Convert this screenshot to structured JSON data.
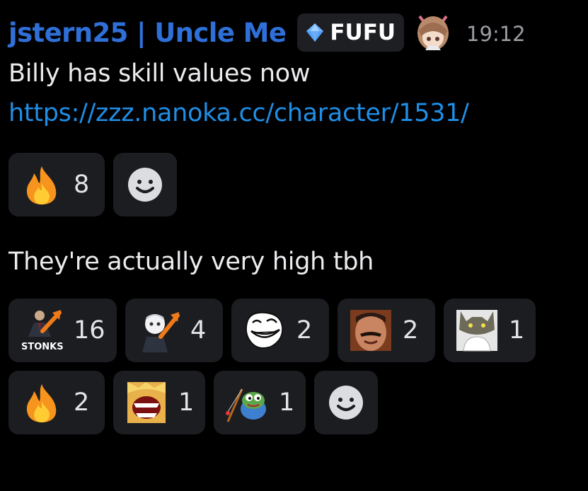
{
  "message_header": {
    "username": "jstern25 | Uncle Me",
    "username_color": "#2f6fd8",
    "tag_icon": "gem-icon",
    "tag_label": "FUFU",
    "timestamp": "19:12"
  },
  "messages": [
    {
      "text": "Billy has skill values now",
      "link": "https://zzz.nanoka.cc/character/1531/",
      "link_color": "#1f8ee6",
      "reactions": [
        {
          "emoji": "fire-emoji",
          "count": "8"
        }
      ]
    },
    {
      "text": "They're actually very high tbh",
      "reactions": [
        {
          "emoji": "stonks-emoji",
          "count": "16",
          "caption": "STONKS"
        },
        {
          "emoji": "anime-stonks-emoji",
          "count": "4"
        },
        {
          "emoji": "troll-face-emoji",
          "count": "2"
        },
        {
          "emoji": "laughing-man-emoji",
          "count": "2"
        },
        {
          "emoji": "cat-emoji",
          "count": "1"
        },
        {
          "emoji": "fire-emoji",
          "count": "2"
        },
        {
          "emoji": "screaming-emoji",
          "count": "1"
        },
        {
          "emoji": "fishing-frog-emoji",
          "count": "1"
        }
      ]
    }
  ],
  "add_reaction_icon": "add-reaction-icon"
}
